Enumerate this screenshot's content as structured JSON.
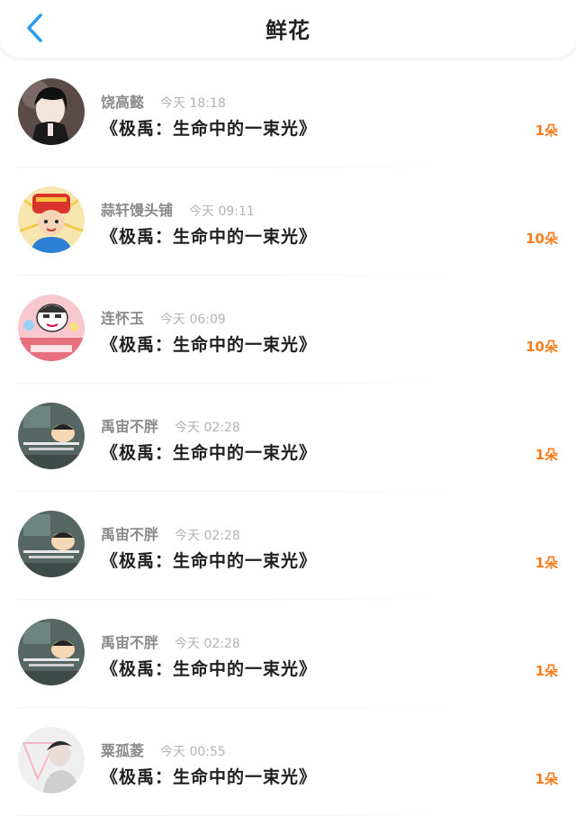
{
  "header": {
    "title": "鲜花",
    "back_icon": "chevron-left-icon",
    "accent_color": "#2a9bef"
  },
  "colors": {
    "count": "#ff7a1a",
    "username": "#8a8a8a",
    "time": "#b3b3b3"
  },
  "items": [
    {
      "user": "饶高懿",
      "time": "今天 18:18",
      "book": "《极禹：生命中的一束光》",
      "count": "1朵",
      "avatar": "avatar-dark-hair"
    },
    {
      "user": "蒜轩馒头铺",
      "time": "今天 09:11",
      "book": "《极禹：生命中的一束光》",
      "count": "10朵",
      "avatar": "avatar-child-hat"
    },
    {
      "user": "连怀玉",
      "time": "今天 06:09",
      "book": "《极禹：生命中的一束光》",
      "count": "10朵",
      "avatar": "avatar-cartoon-pink"
    },
    {
      "user": "禹宙不胖",
      "time": "今天 02:28",
      "book": "《极禹：生命中的一束光》",
      "count": "1朵",
      "avatar": "avatar-cartoon-teal"
    },
    {
      "user": "禹宙不胖",
      "time": "今天 02:28",
      "book": "《极禹：生命中的一束光》",
      "count": "1朵",
      "avatar": "avatar-cartoon-teal"
    },
    {
      "user": "禹宙不胖",
      "time": "今天 02:28",
      "book": "《极禹：生命中的一束光》",
      "count": "1朵",
      "avatar": "avatar-cartoon-teal"
    },
    {
      "user": "粟孤菱",
      "time": "今天 00:55",
      "book": "《极禹：生命中的一束光》",
      "count": "1朵",
      "avatar": "avatar-portrait-light"
    }
  ]
}
